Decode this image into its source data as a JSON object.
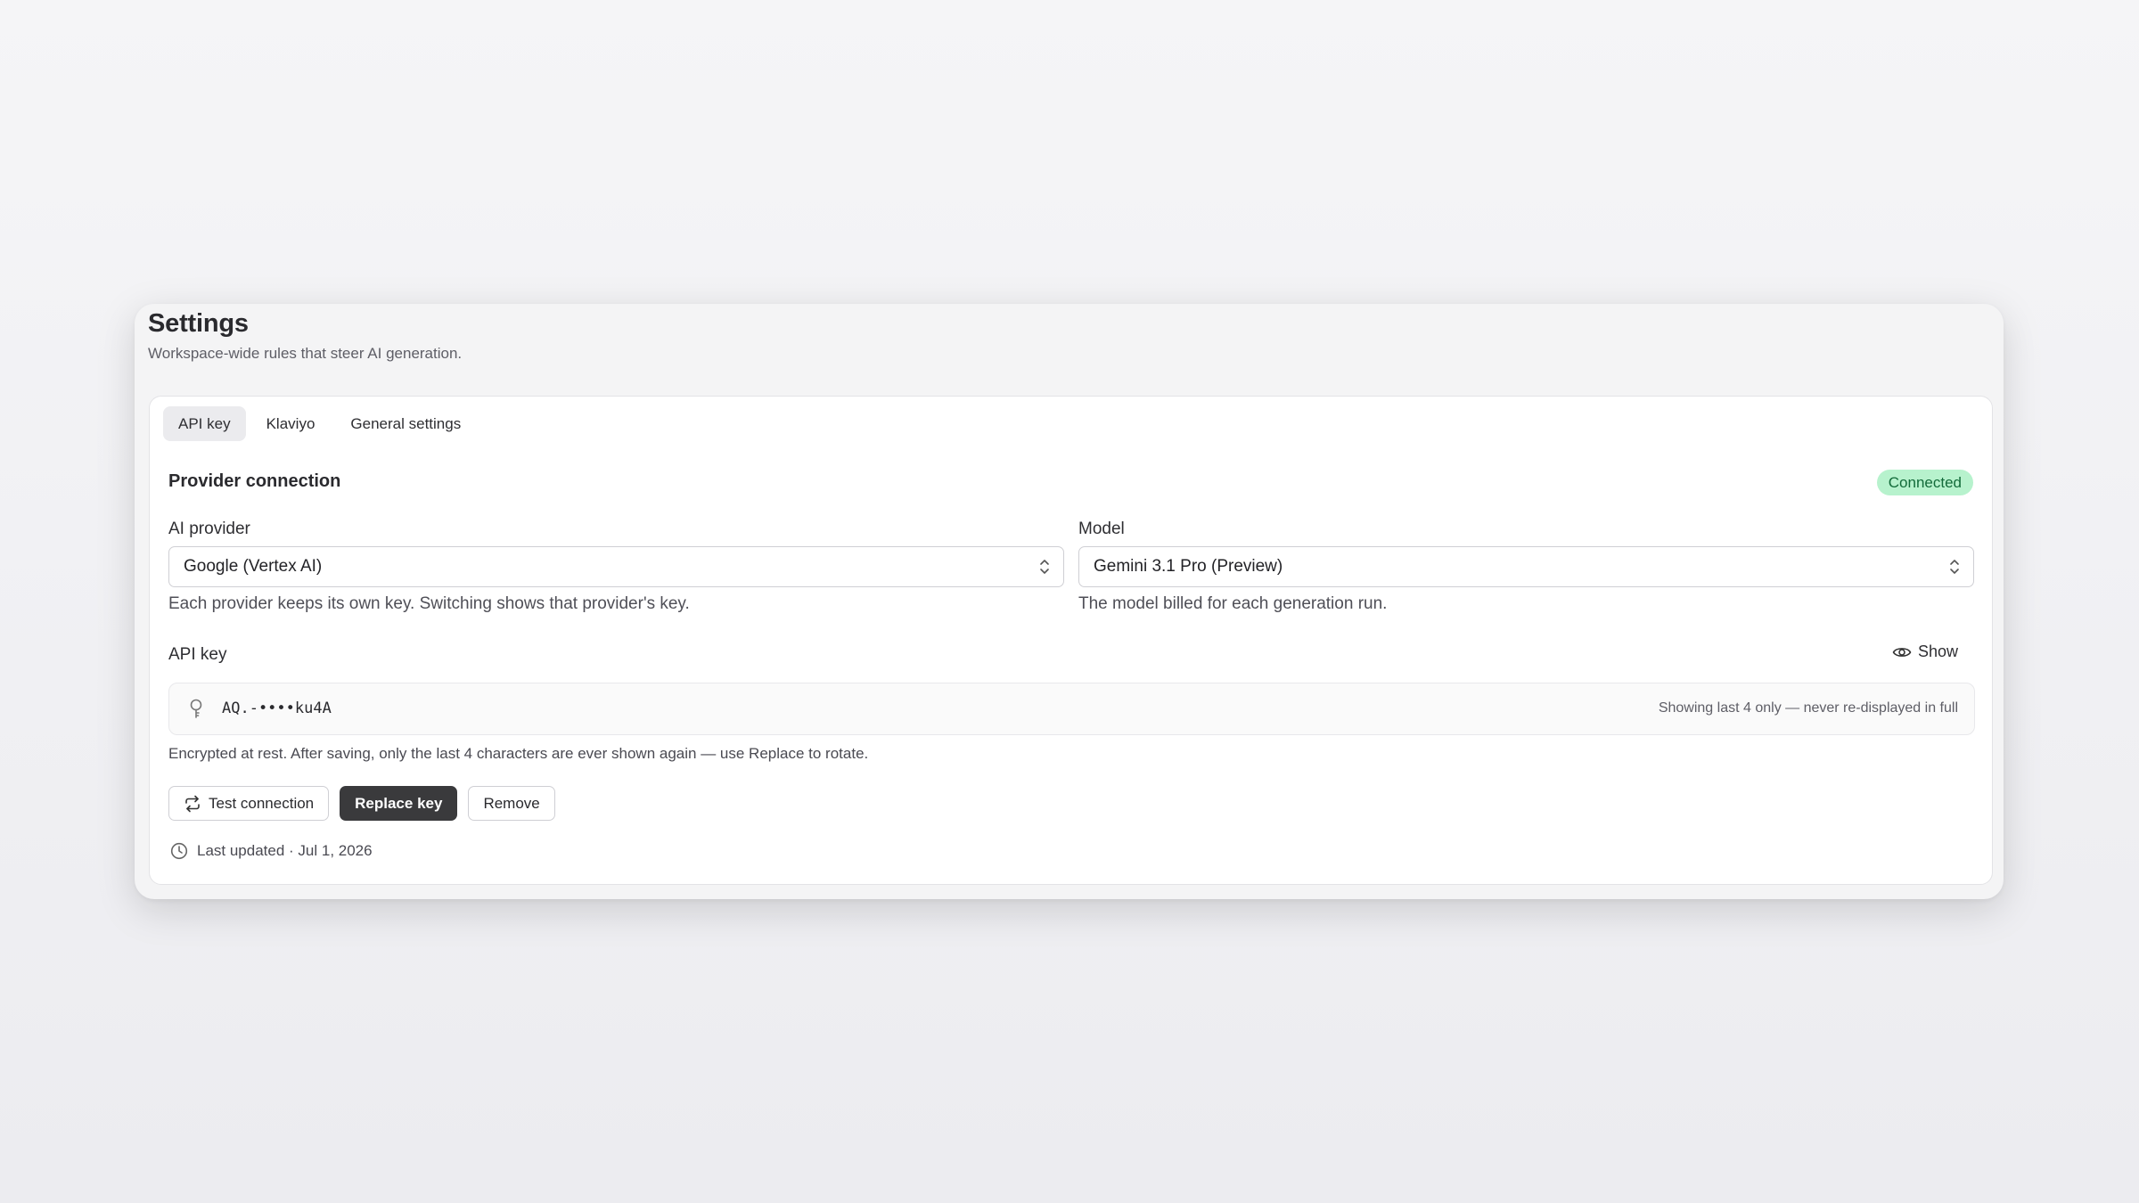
{
  "header": {
    "title": "Settings",
    "subtitle": "Workspace-wide rules that steer AI generation."
  },
  "tabs": [
    {
      "label": "API key",
      "active": true
    },
    {
      "label": "Klaviyo",
      "active": false
    },
    {
      "label": "General settings",
      "active": false
    }
  ],
  "connection": {
    "title": "Provider connection",
    "status": "Connected",
    "status_bg": "#b7f2cd",
    "status_color": "#136b3a"
  },
  "provider": {
    "label": "AI provider",
    "value": "Google (Vertex AI)",
    "helper": "Each provider keeps its own key. Switching shows that provider's key."
  },
  "model": {
    "label": "Model",
    "value": "Gemini 3.1 Pro (Preview)",
    "helper": "The model billed for each generation run."
  },
  "api_key": {
    "label": "API key",
    "show_label": "Show",
    "masked_value": "AQ.-••••ku4A",
    "display_note": "Showing last 4 only — never re-displayed in full",
    "encryption_note": "Encrypted at rest. After saving, only the last 4 characters are ever shown again — use Replace to rotate."
  },
  "actions": {
    "test": "Test connection",
    "replace": "Replace key",
    "remove": "Remove"
  },
  "last_updated": "Last updated · Jul 1, 2026",
  "icons": [
    "refresh-icon",
    "eye-icon",
    "key-icon",
    "clock-icon",
    "chevron-updown-icon"
  ]
}
